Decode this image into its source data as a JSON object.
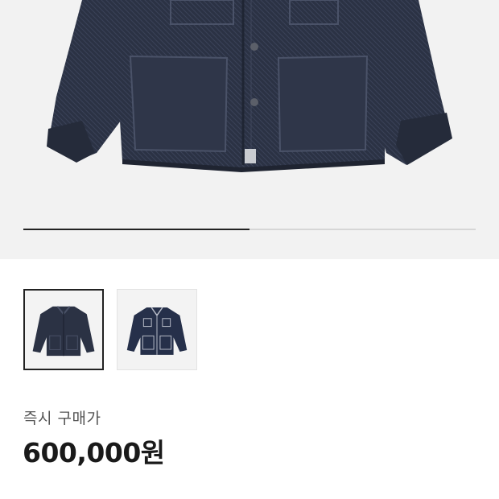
{
  "product": {
    "main_image": "denim-chore-jacket-photo",
    "gallery_progress": 0.5,
    "thumbnails": [
      {
        "icon": "denim-jacket-thumbnail-1",
        "selected": true
      },
      {
        "icon": "denim-jacket-thumbnail-2",
        "selected": false
      }
    ]
  },
  "price": {
    "label": "즉시 구매가",
    "value": "600,000원"
  },
  "colors": {
    "denim": "#2a3142",
    "background": "#f2f2f2",
    "progress_active": "#222222",
    "progress_track": "#d6d6d6"
  }
}
